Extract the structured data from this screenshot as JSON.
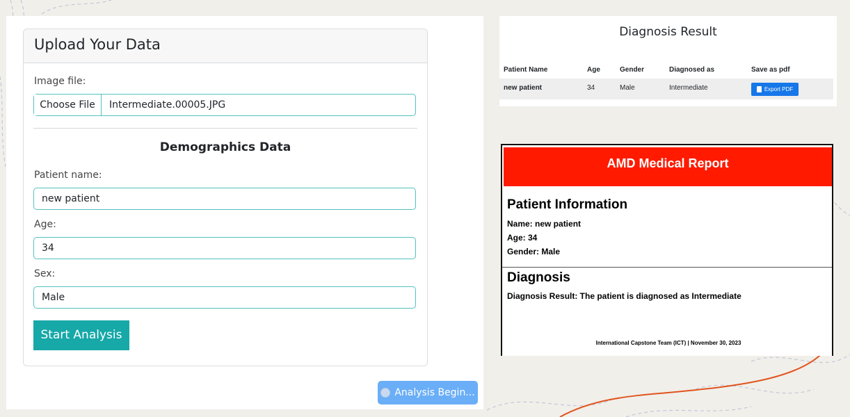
{
  "upload": {
    "title": "Upload Your Data",
    "image_label": "Image file:",
    "choose_file": "Choose File",
    "file_name": "Intermediate.00005.JPG",
    "demographics_title": "Demographics Data",
    "name_label": "Patient name:",
    "name_value": "new patient",
    "age_label": "Age:",
    "age_value": "34",
    "sex_label": "Sex:",
    "sex_value": "Male",
    "start_button": "Start Analysis",
    "analysis_button": "Analysis Begin..."
  },
  "result": {
    "title": "Diagnosis Result",
    "columns": [
      "Patient Name",
      "Age",
      "Gender",
      "Diagnosed as",
      "Save as pdf"
    ],
    "row": {
      "name": "new patient",
      "age": "34",
      "gender": "Male",
      "diagnosis": "Intermediate",
      "export": "Export PDF"
    }
  },
  "report": {
    "title": "AMD Medical Report",
    "patient_info_heading": "Patient Information",
    "name_line": "Name: new patient",
    "age_line": "Age: 34",
    "gender_line": "Gender: Male",
    "diagnosis_heading": "Diagnosis",
    "diagnosis_line": "Diagnosis Result: The patient is diagnosed as Intermediate",
    "footer": "International Capstone Team (ICT) | November 30, 2023"
  },
  "colors": {
    "teal": "#17a8a8",
    "report_red": "#ff1a00",
    "export_blue": "#1677e9",
    "analysis_blue": "#6aaef7"
  }
}
